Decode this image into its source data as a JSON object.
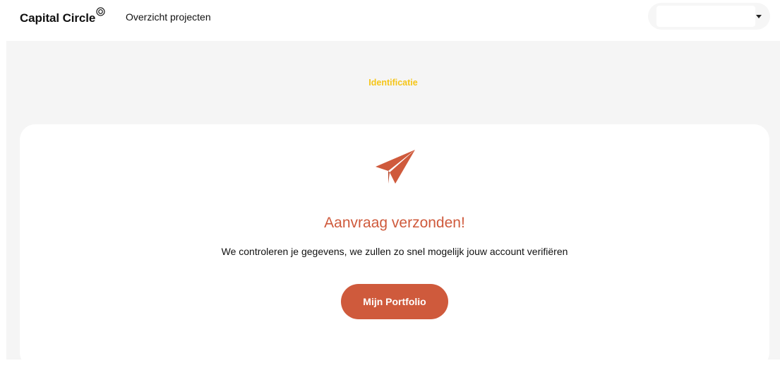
{
  "header": {
    "brand_name": "Capital Circle",
    "brand_mark_icon": "copyright-circle-icon",
    "nav_link": "Overzicht projecten",
    "account_select": {
      "selected_value": "",
      "caret_icon": "caret-down-icon"
    }
  },
  "main": {
    "step_label": "Identificatie",
    "card": {
      "icon": "paper-plane-icon",
      "title": "Aanvraag verzonden!",
      "message": "We controleren je gegevens, we zullen zo snel mogelijk jouw account verifiëren",
      "button_label": "Mijn Portfolio"
    }
  },
  "colors": {
    "accent": "#cf5a3c",
    "step_highlight": "#f5c518",
    "background": "#f5f5f5"
  }
}
